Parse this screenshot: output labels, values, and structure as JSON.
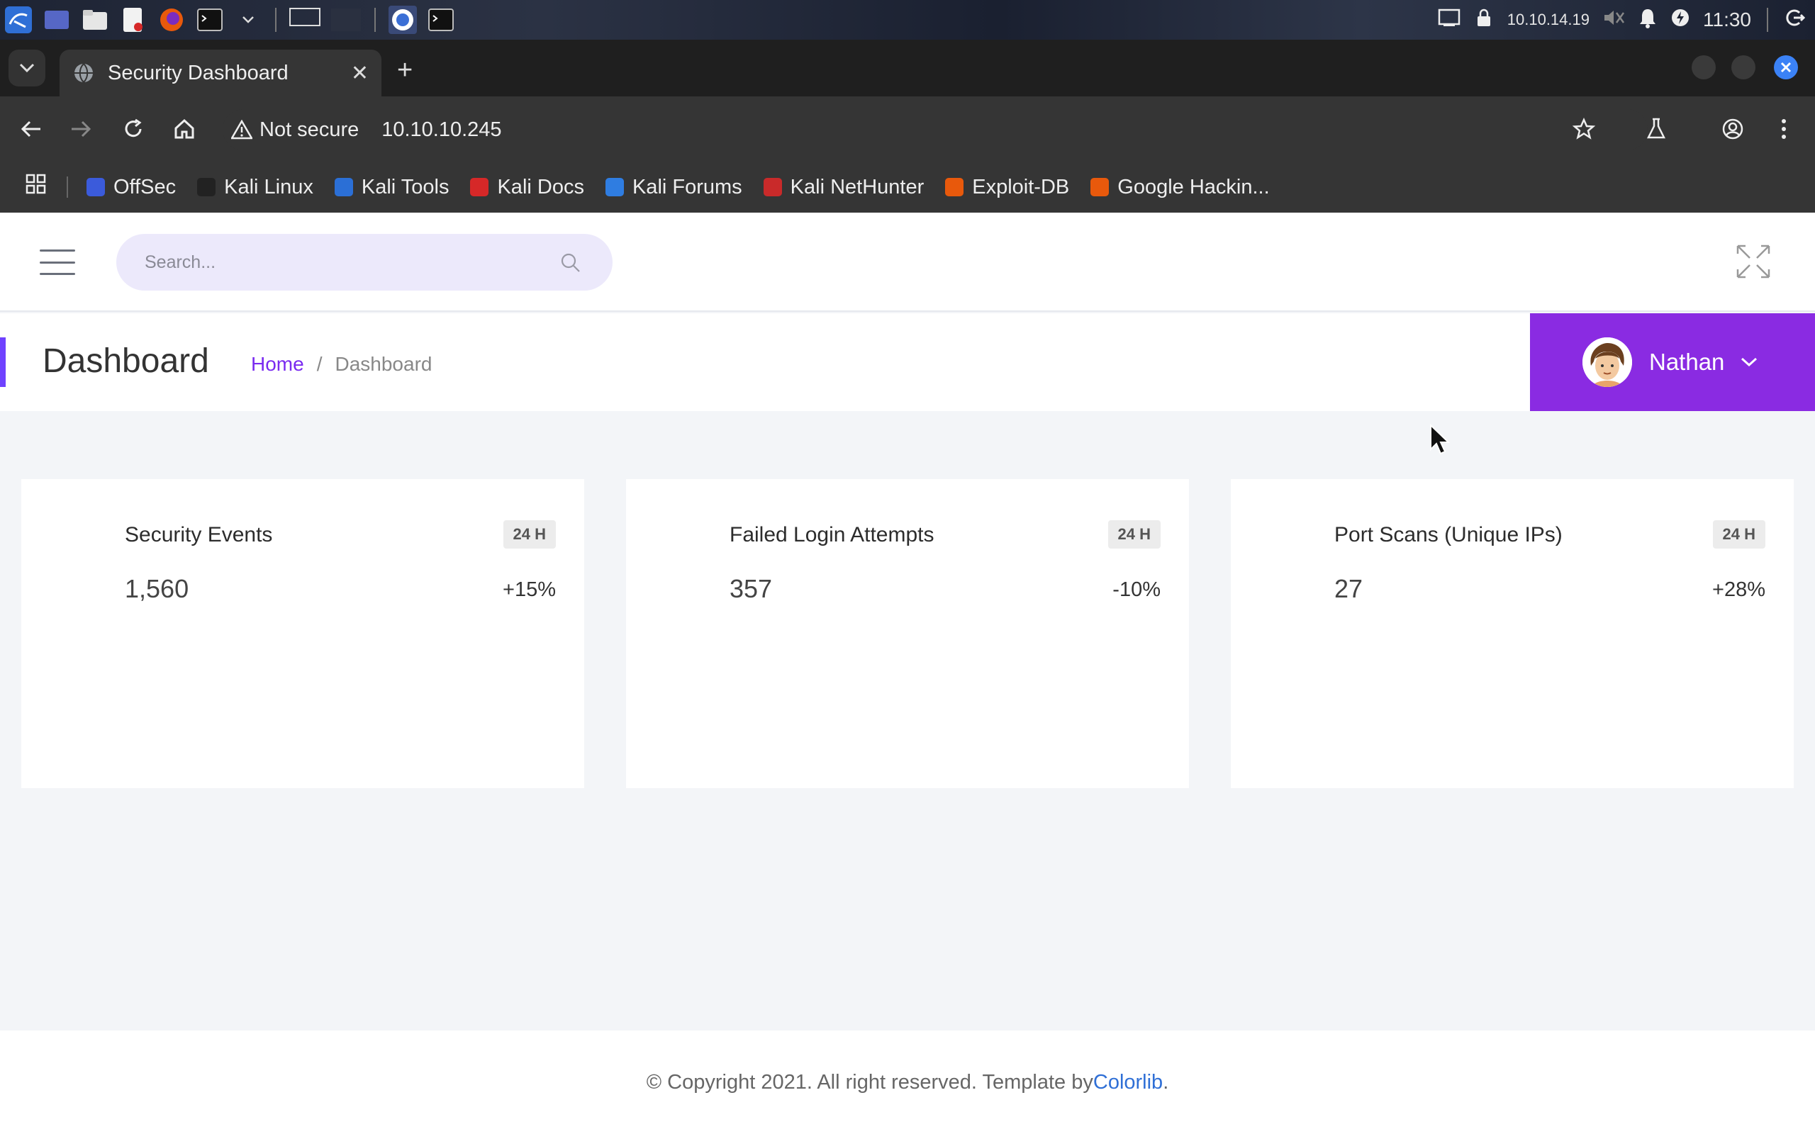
{
  "taskbar": {
    "ip": "10.10.14.19",
    "clock": "11:30"
  },
  "browser": {
    "tab_title": "Security Dashboard",
    "new_tab": "+",
    "tab_close": "✕",
    "security_label": "Not secure",
    "url": "10.10.10.245",
    "bookmarks": [
      {
        "label": "OffSec",
        "color": "#3b5bdb"
      },
      {
        "label": "Kali Linux",
        "color": "#222222"
      },
      {
        "label": "Kali Tools",
        "color": "#2b6fd6"
      },
      {
        "label": "Kali Docs",
        "color": "#d62828"
      },
      {
        "label": "Kali Forums",
        "color": "#2f7de1"
      },
      {
        "label": "Kali NetHunter",
        "color": "#c92a2a"
      },
      {
        "label": "Exploit-DB",
        "color": "#e8590c"
      },
      {
        "label": "Google Hackin...",
        "color": "#e8590c"
      }
    ]
  },
  "header": {
    "search_placeholder": "Search..."
  },
  "page": {
    "title": "Dashboard",
    "breadcrumb_home": "Home",
    "breadcrumb_sep": "/",
    "breadcrumb_current": "Dashboard",
    "user_name": "Nathan"
  },
  "cards": [
    {
      "title": "Security Events",
      "period": "24 H",
      "value": "1,560",
      "delta": "+15%"
    },
    {
      "title": "Failed Login Attempts",
      "period": "24 H",
      "value": "357",
      "delta": "-10%"
    },
    {
      "title": "Port Scans (Unique IPs)",
      "period": "24 H",
      "value": "27",
      "delta": "+28%"
    }
  ],
  "footer": {
    "text": "© Copyright 2021. All right reserved. Template by ",
    "link": "Colorlib",
    "end": "."
  },
  "colors": {
    "accent": "#8a2be2",
    "link": "#2f6fd6"
  }
}
